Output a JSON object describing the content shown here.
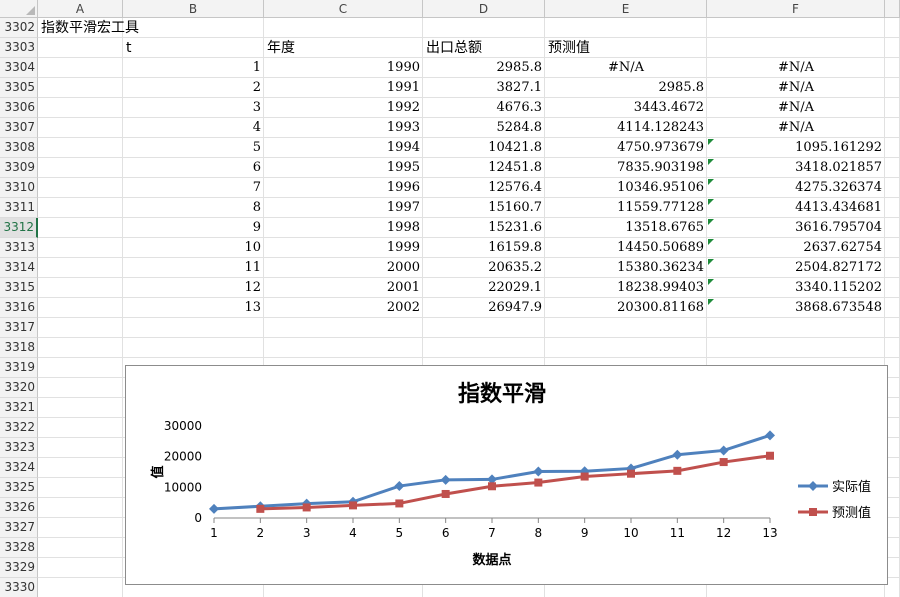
{
  "columns": [
    "A",
    "B",
    "C",
    "D",
    "E",
    "F"
  ],
  "rows": [
    "3302",
    "3303",
    "3304",
    "3305",
    "3306",
    "3307",
    "3308",
    "3309",
    "3310",
    "3311",
    "3312",
    "3313",
    "3314",
    "3315",
    "3316",
    "3317",
    "3318",
    "3319",
    "3320",
    "3321",
    "3322",
    "3323",
    "3324",
    "3325",
    "3326",
    "3327",
    "3328",
    "3329",
    "3330"
  ],
  "active_row": "3312",
  "title_cell": "指数平滑宏工具",
  "headers": {
    "t": "t",
    "year": "年度",
    "export": "出口总额",
    "forecast": "预测值"
  },
  "table": [
    {
      "t": "1",
      "year": "1990",
      "export": "2985.8",
      "forecast": "#N/A",
      "err": "#N/A"
    },
    {
      "t": "2",
      "year": "1991",
      "export": "3827.1",
      "forecast": "2985.8",
      "err": "#N/A"
    },
    {
      "t": "3",
      "year": "1992",
      "export": "4676.3",
      "forecast": "3443.4672",
      "err": "#N/A"
    },
    {
      "t": "4",
      "year": "1993",
      "export": "5284.8",
      "forecast": "4114.128243",
      "err": "#N/A"
    },
    {
      "t": "5",
      "year": "1994",
      "export": "10421.8",
      "forecast": "4750.973679",
      "err": "1095.161292"
    },
    {
      "t": "6",
      "year": "1995",
      "export": "12451.8",
      "forecast": "7835.903198",
      "err": "3418.021857"
    },
    {
      "t": "7",
      "year": "1996",
      "export": "12576.4",
      "forecast": "10346.95106",
      "err": "4275.326374"
    },
    {
      "t": "8",
      "year": "1997",
      "export": "15160.7",
      "forecast": "11559.77128",
      "err": "4413.434681"
    },
    {
      "t": "9",
      "year": "1998",
      "export": "15231.6",
      "forecast": "13518.6765",
      "err": "3616.795704"
    },
    {
      "t": "10",
      "year": "1999",
      "export": "16159.8",
      "forecast": "14450.50689",
      "err": "2637.62754"
    },
    {
      "t": "11",
      "year": "2000",
      "export": "20635.2",
      "forecast": "15380.36234",
      "err": "2504.827172"
    },
    {
      "t": "12",
      "year": "2001",
      "export": "22029.1",
      "forecast": "18238.99403",
      "err": "3340.115202"
    },
    {
      "t": "13",
      "year": "2002",
      "export": "26947.9",
      "forecast": "20300.81168",
      "err": "3868.673548"
    }
  ],
  "chart_data": {
    "type": "line",
    "title": "指数平滑",
    "xlabel": "数据点",
    "ylabel": "值",
    "x": [
      1,
      2,
      3,
      4,
      5,
      6,
      7,
      8,
      9,
      10,
      11,
      12,
      13
    ],
    "ylim": [
      0,
      30000
    ],
    "yticks": [
      0,
      10000,
      20000,
      30000
    ],
    "legend_position": "right",
    "series": [
      {
        "name": "实际值",
        "color": "#4F81BD",
        "marker": "diamond",
        "values": [
          2985.8,
          3827.1,
          4676.3,
          5284.8,
          10421.8,
          12451.8,
          12576.4,
          15160.7,
          15231.6,
          16159.8,
          20635.2,
          22029.1,
          26947.9
        ]
      },
      {
        "name": "预测值",
        "color": "#C0504D",
        "marker": "square",
        "values": [
          null,
          2985.8,
          3443.4672,
          4114.128243,
          4750.973679,
          7835.903198,
          10346.95106,
          11559.77128,
          13518.6765,
          14450.50689,
          15380.36234,
          18238.99403,
          20300.81168
        ]
      }
    ]
  }
}
